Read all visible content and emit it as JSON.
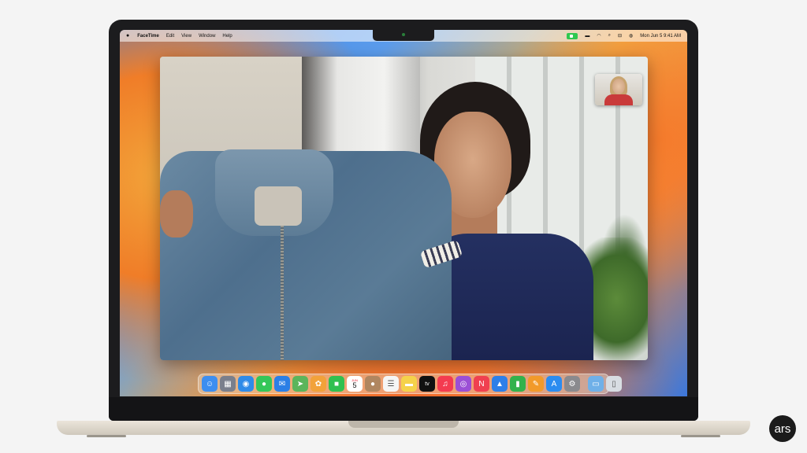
{
  "menubar": {
    "app_name": "FaceTime",
    "menus": [
      "Edit",
      "View",
      "Window",
      "Help"
    ],
    "clock": "Mon Jun 5  9:41 AM",
    "icons": [
      "apple-icon",
      "facetime-indicator-icon",
      "battery-icon",
      "wifi-icon",
      "search-icon",
      "control-center-icon",
      "siri-icon"
    ]
  },
  "calendar": {
    "month": "JUN",
    "day": "5"
  },
  "dock": {
    "apps": [
      {
        "name": "finder",
        "glyph": "☺",
        "color": "#3d8ef0"
      },
      {
        "name": "launchpad",
        "glyph": "▦",
        "color": "#7a7f8c"
      },
      {
        "name": "safari",
        "glyph": "◉",
        "color": "#2f8be8"
      },
      {
        "name": "messages",
        "glyph": "●",
        "color": "#34c759"
      },
      {
        "name": "mail",
        "glyph": "✉",
        "color": "#2b7fe6"
      },
      {
        "name": "maps",
        "glyph": "➤",
        "color": "#5bb55b"
      },
      {
        "name": "photos",
        "glyph": "✿",
        "color": "#f2a23a"
      },
      {
        "name": "facetime",
        "glyph": "■",
        "color": "#30c050"
      },
      {
        "name": "calendar",
        "glyph": "",
        "color": "#ffffff"
      },
      {
        "name": "contacts",
        "glyph": "●",
        "color": "#b08660"
      },
      {
        "name": "reminders",
        "glyph": "☰",
        "color": "#f5f5f5"
      },
      {
        "name": "notes",
        "glyph": "▬",
        "color": "#f5d24a"
      },
      {
        "name": "tv",
        "glyph": "tv",
        "color": "#111111"
      },
      {
        "name": "music",
        "glyph": "♫",
        "color": "#f43b50"
      },
      {
        "name": "podcasts",
        "glyph": "◎",
        "color": "#9b4fd6"
      },
      {
        "name": "news",
        "glyph": "N",
        "color": "#f04050"
      },
      {
        "name": "keynote",
        "glyph": "▲",
        "color": "#2d7fe8"
      },
      {
        "name": "numbers",
        "glyph": "▮",
        "color": "#32b24c"
      },
      {
        "name": "pages",
        "glyph": "✎",
        "color": "#f29a2a"
      },
      {
        "name": "app-store",
        "glyph": "A",
        "color": "#2b8cf0"
      },
      {
        "name": "system-settings",
        "glyph": "⚙",
        "color": "#8a8a8e"
      }
    ],
    "extras": [
      {
        "name": "downloads-folder",
        "glyph": "▭",
        "color": "#6fb0e8"
      },
      {
        "name": "trash",
        "glyph": "▯",
        "color": "#d8dde3"
      }
    ]
  },
  "watermark": {
    "logo_text": "ars"
  }
}
